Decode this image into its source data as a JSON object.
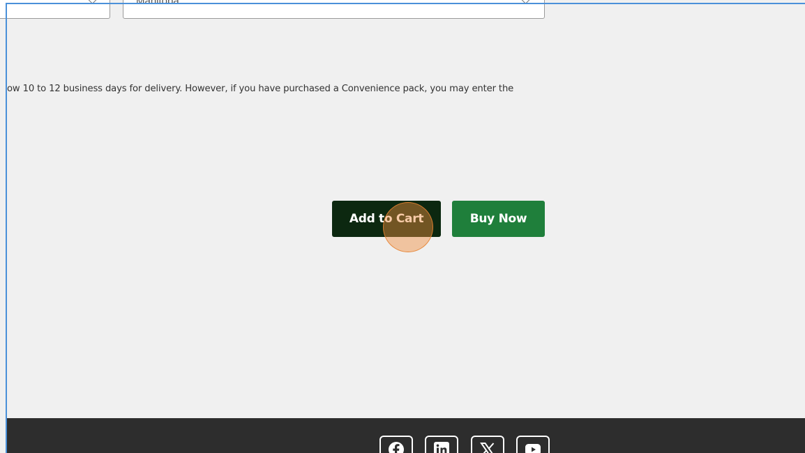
{
  "form": {
    "country_select": {
      "value": ""
    },
    "province_select": {
      "value": "Manitoba"
    }
  },
  "notice": {
    "text": "ow 10 to 12 business days for delivery. However, if you have purchased a Convenience pack, you may enter the"
  },
  "actions": {
    "add_to_cart_label": "Add to Cart",
    "buy_now_label": "Buy Now"
  },
  "footer": {
    "social_icons": [
      "facebook-icon",
      "linkedin-icon",
      "x-icon",
      "youtube-icon"
    ]
  },
  "colors": {
    "page_background": "#f0f0f0",
    "add_to_cart_bg": "#0c2810",
    "buy_now_bg": "#1f7f3b",
    "footer_bg": "#2d2d2d",
    "frame_accent": "#4a90d9",
    "click_indicator": "#f08c3c"
  }
}
